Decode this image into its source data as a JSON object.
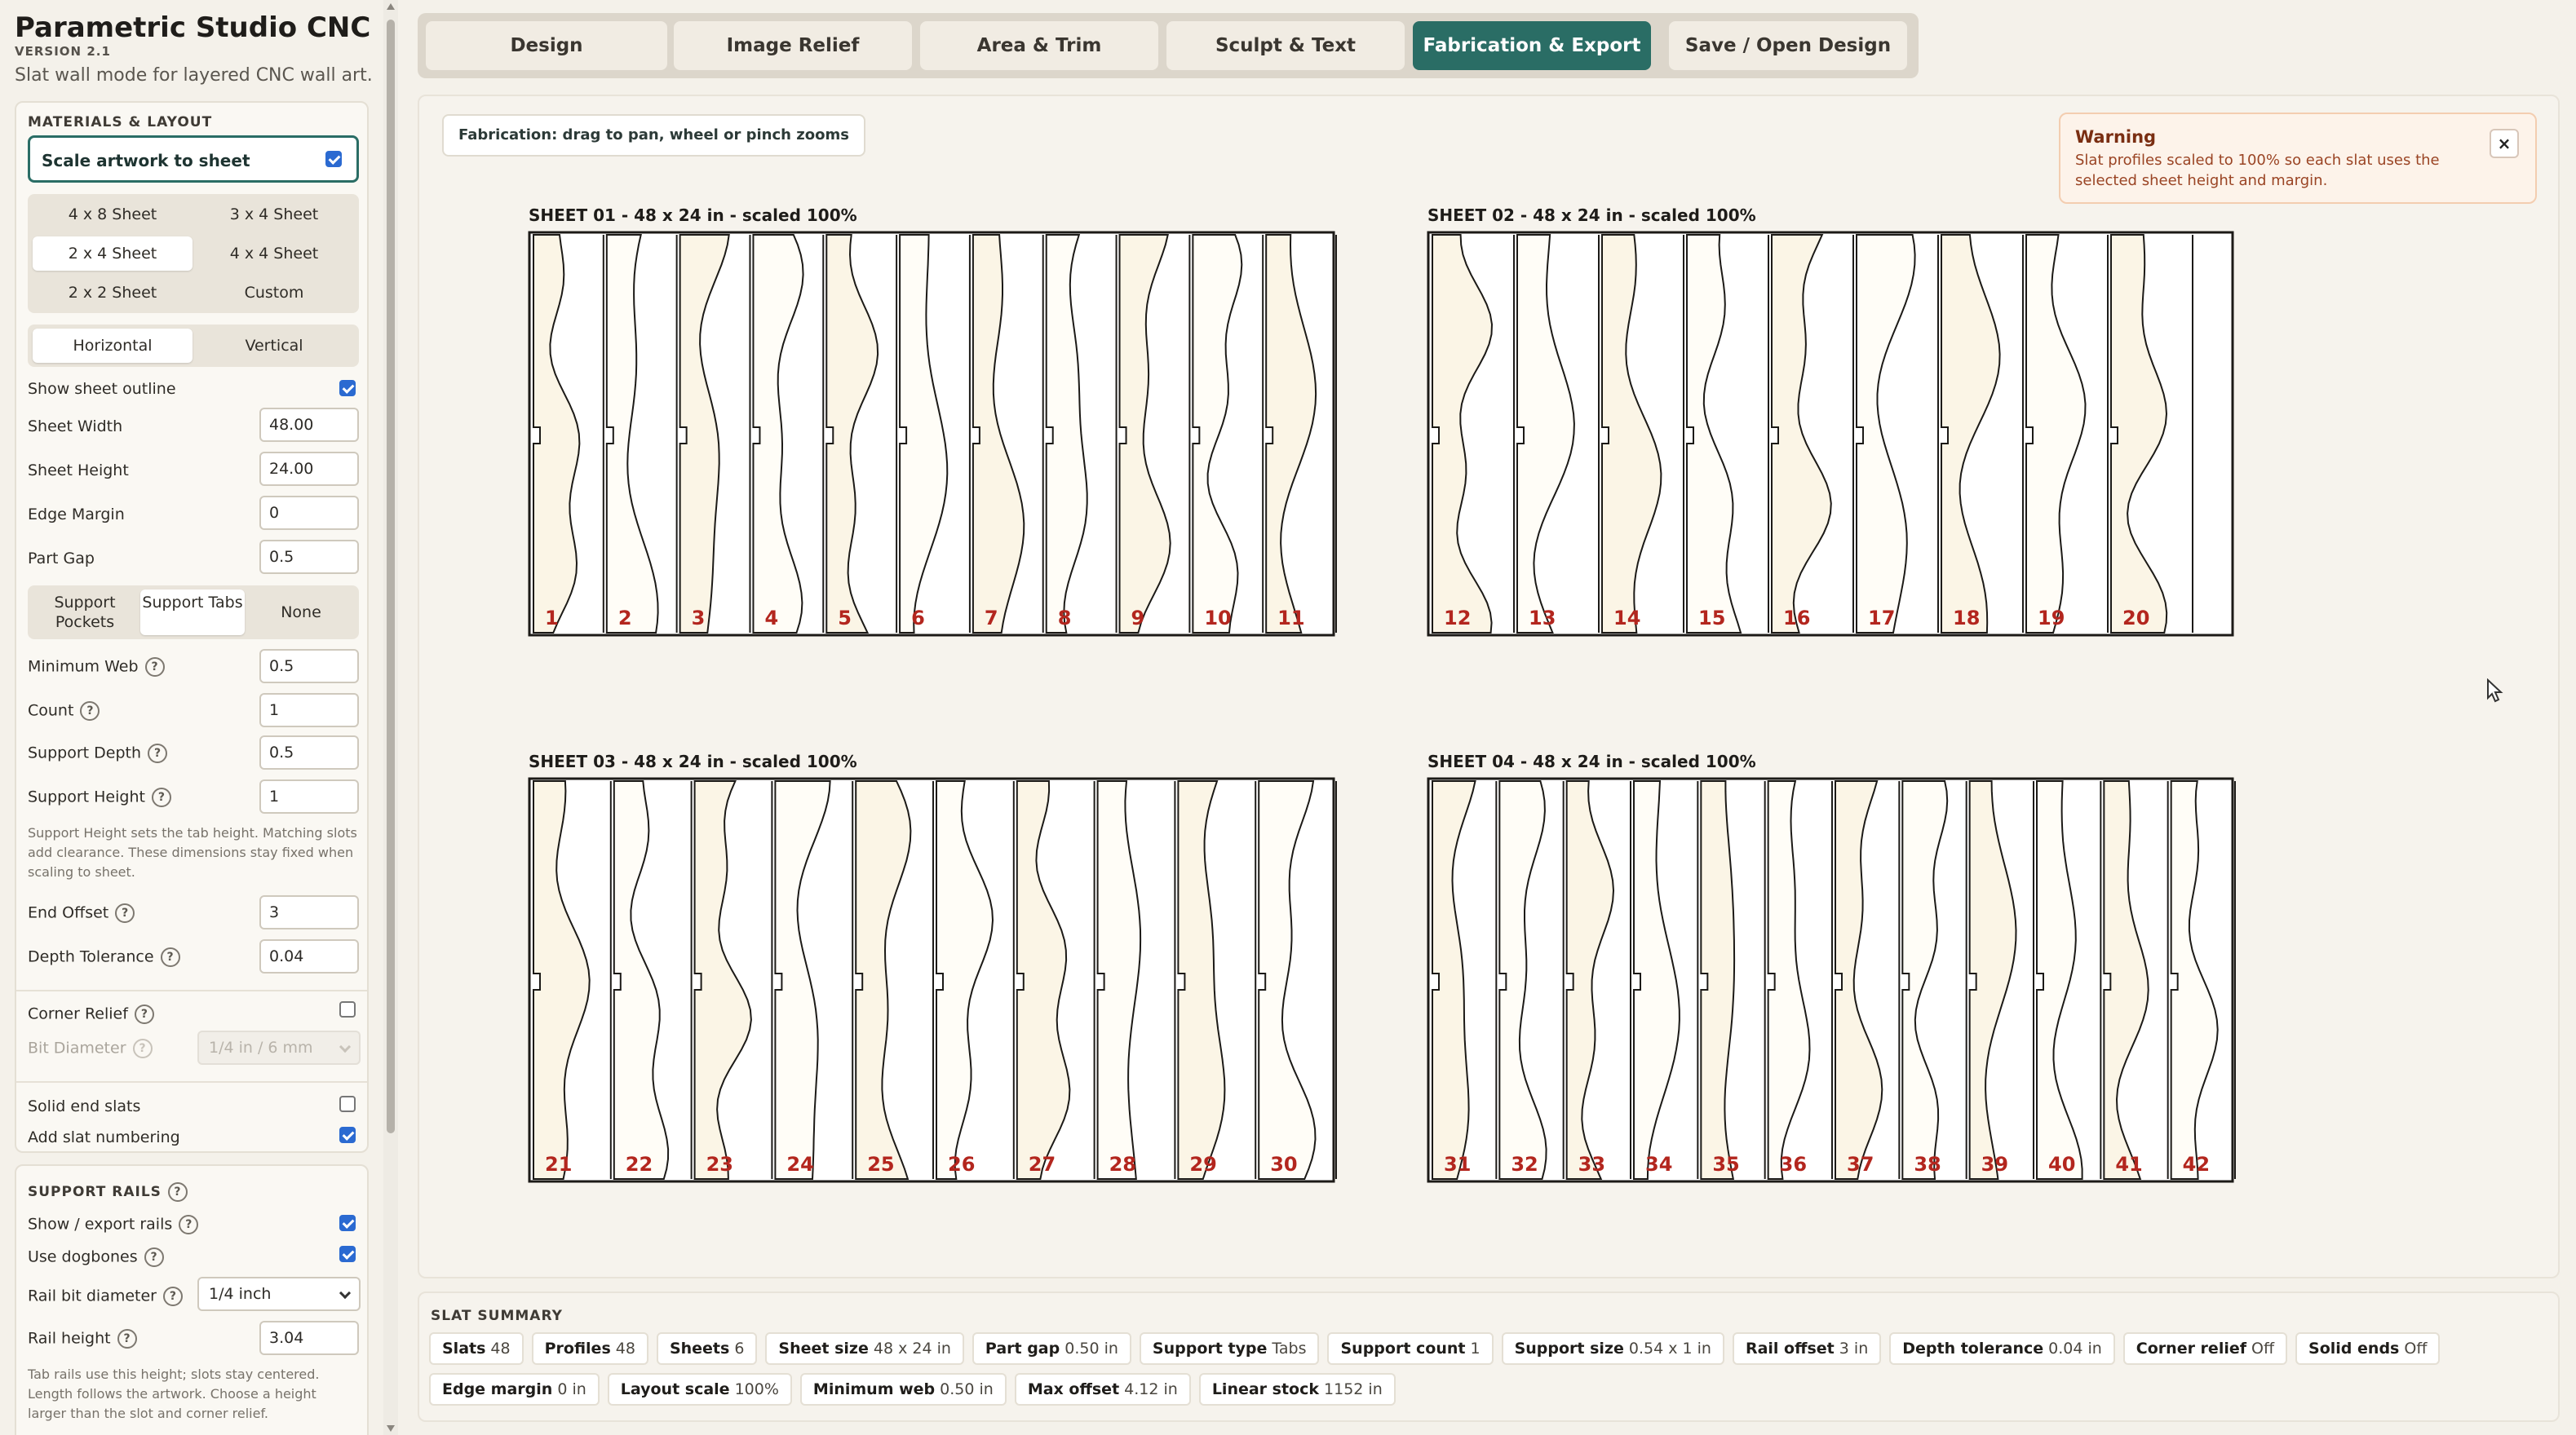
{
  "app": {
    "title": "Parametric Studio CNC",
    "version": "VERSION 2.1",
    "subtitle": "Slat wall mode for layered CNC wall art."
  },
  "materials": {
    "section_title": "MATERIALS & LAYOUT",
    "scale_label": "Scale artwork to sheet",
    "scale_checked": true,
    "sheet_presets": [
      "4 x 8 Sheet",
      "3 x 4 Sheet",
      "2 x 4 Sheet",
      "4 x 4 Sheet",
      "2 x 2 Sheet",
      "Custom"
    ],
    "sheet_preset_selected": "2 x 4 Sheet",
    "orientation": [
      "Horizontal",
      "Vertical"
    ],
    "orientation_selected": "Horizontal",
    "show_outline_label": "Show sheet outline",
    "show_outline_checked": true,
    "sheet_width_label": "Sheet Width",
    "sheet_width": "48.00",
    "sheet_height_label": "Sheet Height",
    "sheet_height": "24.00",
    "edge_margin_label": "Edge Margin",
    "edge_margin": "0",
    "part_gap_label": "Part Gap",
    "part_gap": "0.5",
    "support_modes": [
      "Support Pockets",
      "Support Tabs",
      "None"
    ],
    "support_mode_selected": "Support Tabs",
    "min_web_label": "Minimum Web",
    "min_web": "0.5",
    "count_label": "Count",
    "count": "1",
    "support_depth_label": "Support Depth",
    "support_depth": "0.5",
    "support_height_label": "Support Height",
    "support_height": "1",
    "support_note": "Support Height sets the tab height. Matching slots add clearance. These dimensions stay fixed when scaling to sheet.",
    "end_offset_label": "End Offset",
    "end_offset": "3",
    "depth_tol_label": "Depth Tolerance",
    "depth_tol": "0.04",
    "corner_relief_label": "Corner Relief",
    "corner_relief_checked": false,
    "bit_diameter_label": "Bit Diameter",
    "bit_diameter": "1/4 in / 6 mm",
    "solid_end_label": "Solid end slats",
    "solid_end_checked": false,
    "numbering_label": "Add slat numbering",
    "numbering_checked": true,
    "help": "?"
  },
  "rails": {
    "section_title": "SUPPORT RAILS",
    "show_export_label": "Show / export rails",
    "show_export_checked": true,
    "dogbones_label": "Use dogbones",
    "dogbones_checked": true,
    "rail_bit_label": "Rail bit diameter",
    "rail_bit": "1/4 inch",
    "rail_height_label": "Rail height",
    "rail_height": "3.04",
    "rail_note": "Tab rails use this height; slots stay centered. Length follows the artwork. Choose a height larger than the slot and corner relief."
  },
  "tabs": [
    "Design",
    "Image Relief",
    "Area & Trim",
    "Sculpt & Text",
    "Fabrication & Export",
    "Save / Open Design"
  ],
  "active_tab": "Fabrication & Export",
  "canvas": {
    "hint": "Fabrication: drag to pan, wheel or pinch zooms",
    "warning_title": "Warning",
    "warning_message": "Slat profiles scaled to 100% so each slat uses the selected sheet height and margin.",
    "warning_close": "×",
    "sheets": [
      {
        "title": "SHEET 01 - 48 x 24 in - scaled 100%",
        "slats": [
          1,
          2,
          3,
          4,
          5,
          6,
          7,
          8,
          9,
          10,
          11
        ]
      },
      {
        "title": "SHEET 02 - 48 x 24 in - scaled 100%",
        "slats": [
          12,
          13,
          14,
          15,
          16,
          17,
          18,
          19,
          20
        ]
      },
      {
        "title": "SHEET 03 - 48 x 24 in - scaled 100%",
        "slats": [
          21,
          22,
          23,
          24,
          25,
          26,
          27,
          28,
          29,
          30
        ]
      },
      {
        "title": "SHEET 04 - 48 x 24 in - scaled 100%",
        "slats": [
          31,
          32,
          33,
          34,
          35,
          36,
          37,
          38,
          39,
          40,
          41,
          42
        ]
      }
    ],
    "colors": {
      "outline": "#1c1a17",
      "slat_fill": "#fbf5e6",
      "number": "#b3261e",
      "accent": "#2a6d65"
    }
  },
  "summary": {
    "title": "SLAT SUMMARY",
    "items": [
      {
        "k": "Slats",
        "v": "48"
      },
      {
        "k": "Profiles",
        "v": "48"
      },
      {
        "k": "Sheets",
        "v": "6"
      },
      {
        "k": "Sheet size",
        "v": "48 x 24 in"
      },
      {
        "k": "Part gap",
        "v": "0.50 in"
      },
      {
        "k": "Support type",
        "v": "Tabs"
      },
      {
        "k": "Support count",
        "v": "1"
      },
      {
        "k": "Support size",
        "v": "0.54 x 1 in"
      },
      {
        "k": "Rail offset",
        "v": "3 in"
      },
      {
        "k": "Depth tolerance",
        "v": "0.04 in"
      },
      {
        "k": "Corner relief",
        "v": "Off"
      },
      {
        "k": "Solid ends",
        "v": "Off"
      },
      {
        "k": "Edge margin",
        "v": "0 in"
      },
      {
        "k": "Layout scale",
        "v": "100%"
      },
      {
        "k": "Minimum web",
        "v": "0.50 in"
      },
      {
        "k": "Max offset",
        "v": "4.12 in"
      },
      {
        "k": "Linear stock",
        "v": "1152 in"
      }
    ]
  }
}
